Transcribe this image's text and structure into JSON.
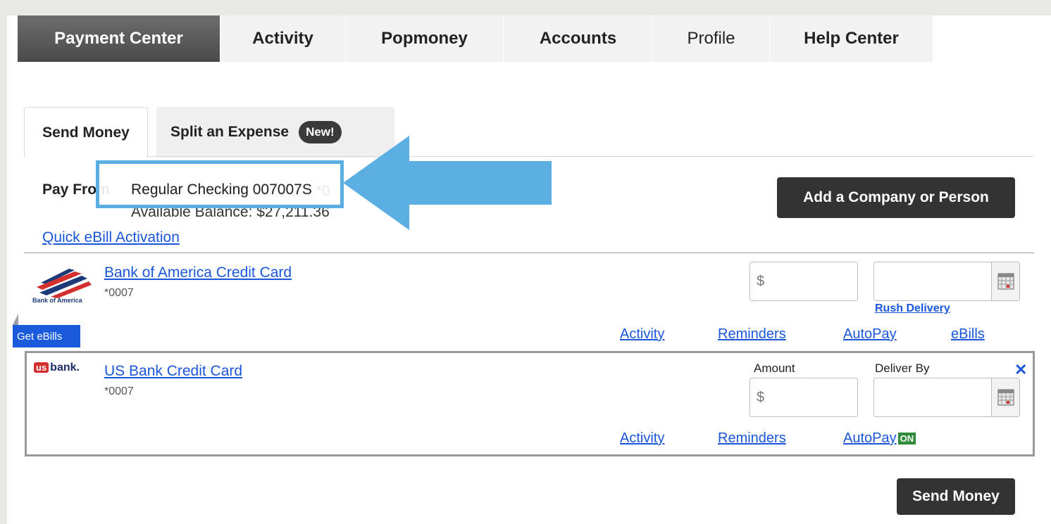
{
  "nav": {
    "tabs": [
      {
        "label": "Payment Center",
        "active": true
      },
      {
        "label": "Activity"
      },
      {
        "label": "Popmoney"
      },
      {
        "label": "Accounts"
      },
      {
        "label": "Profile"
      },
      {
        "label": "Help Center"
      }
    ]
  },
  "subtabs": {
    "send_money": "Send Money",
    "split_expense": "Split an Expense",
    "new_badge": "New!"
  },
  "pay_from": {
    "label": "Pay From",
    "account": "Regular Checking 007007S",
    "account_suffix": "*0",
    "available_balance": "Available Balance: $27,211.36"
  },
  "add_button": "Add a Company or Person",
  "quick_ebill": "Quick eBill Activation",
  "payees": [
    {
      "logo_text": "Bank of America",
      "name": "Bank of America Credit Card",
      "acct": "*0007",
      "amount_placeholder": "$",
      "rush": "Rush Delivery",
      "links": {
        "activity": "Activity",
        "reminders": "Reminders",
        "autopay": "AutoPay",
        "ebills": "eBills"
      }
    },
    {
      "logo_text": "bank.",
      "logo_mark": "us",
      "name": "US Bank Credit Card",
      "acct": "*0007",
      "amount_label": "Amount",
      "deliver_label": "Deliver By",
      "amount_placeholder": "$",
      "links": {
        "activity": "Activity",
        "reminders": "Reminders",
        "autopay": "AutoPay",
        "autopay_status": "ON"
      }
    }
  ],
  "get_ebills": "Get eBills",
  "close_glyph": "✕",
  "send_button": "Send Money",
  "colors": {
    "highlight": "#5aaee1",
    "link": "#1a56db",
    "autopay_on": "#2e8b3a"
  }
}
